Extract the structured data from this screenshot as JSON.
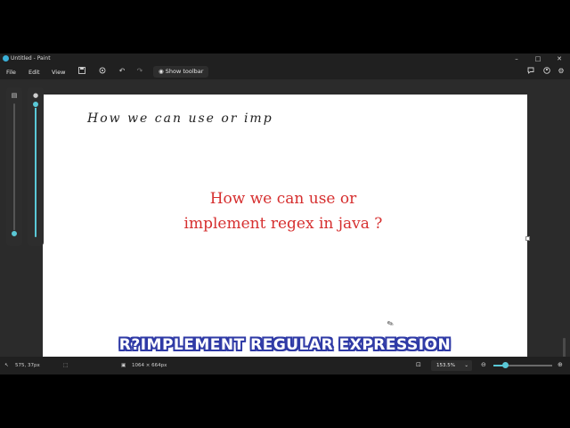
{
  "window": {
    "title": "Untitled - Paint"
  },
  "titlebar": {
    "minimize_icon": "minimize-icon",
    "maximize_icon": "maximize-icon",
    "close_icon": "close-icon"
  },
  "menubar": {
    "items": [
      {
        "label": "File"
      },
      {
        "label": "Edit"
      },
      {
        "label": "View"
      }
    ],
    "show_toolbar_label": "Show toolbar"
  },
  "canvas": {
    "handwriting": "How we can use or imp",
    "red_text_line1": "How we can use or",
    "red_text_line2": "implement regex in java ?"
  },
  "statusbar": {
    "cursor_position": "575, 37px",
    "canvas_size": "1064 × 664px",
    "zoom": "153.5%"
  },
  "caption": "R?Implement Regular Expression",
  "colors": {
    "accent": "#5ac8d6",
    "text_red": "#d62f2f",
    "caption_outline": "#2f3aa6",
    "background": "#202020"
  }
}
